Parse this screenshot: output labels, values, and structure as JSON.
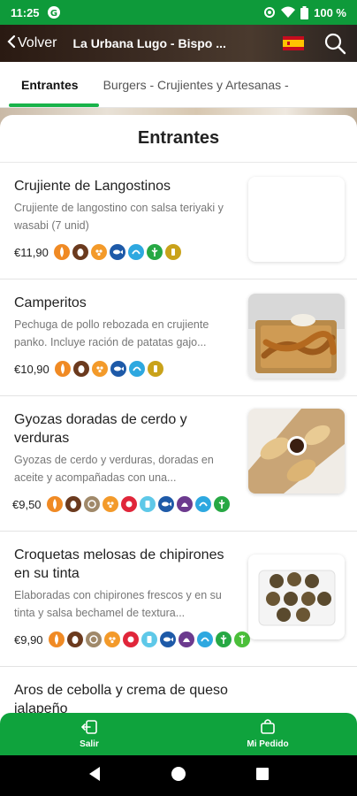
{
  "status_bar": {
    "time": "11:25",
    "battery": "100 %"
  },
  "header": {
    "back_label": "Volver",
    "store_title": "La Urbana Lugo - Bispo ..."
  },
  "tabs": [
    {
      "label": "Entrantes",
      "active": true
    },
    {
      "label": "Burgers - Crujientes y Artesanas -",
      "active": false
    }
  ],
  "section": {
    "title": "Entrantes"
  },
  "items": [
    {
      "name": "Crujiente de Langostinos",
      "description": "Crujiente de langostino con salsa teriyaki y wasabi (7 unid)",
      "price": "€11,90",
      "allergens": [
        "gluten-icon",
        "eggs-icon",
        "sesame-icon",
        "fish-icon",
        "crustacean-icon",
        "celery-icon",
        "mustard-icon"
      ]
    },
    {
      "name": "Camperitos",
      "description": "Pechuga de pollo rebozada en crujiente panko. Incluye ración de patatas gajo...",
      "price": "€10,90",
      "allergens": [
        "gluten-icon",
        "eggs-icon",
        "sesame-icon",
        "fish-icon",
        "crustacean-icon",
        "mustard-icon"
      ]
    },
    {
      "name": "Gyozas doradas de cerdo y verduras",
      "description": "Gyozas de cerdo y verduras, doradas en aceite y acompañadas con una...",
      "price": "€9,50",
      "allergens": [
        "gluten-icon",
        "eggs-icon",
        "nuts-icon",
        "sesame-icon",
        "soy-icon",
        "milk-icon",
        "fish-icon",
        "mollusc-icon",
        "crustacean-icon",
        "celery-icon"
      ]
    },
    {
      "name": "Croquetas melosas de chipirones en su tinta",
      "description": "Elaboradas con chipirones frescos y en su tinta y salsa bechamel de textura...",
      "price": "€9,90",
      "allergens": [
        "gluten-icon",
        "eggs-icon",
        "nuts-icon",
        "sesame-icon",
        "soy-icon",
        "milk-icon",
        "fish-icon",
        "mollusc-icon",
        "crustacean-icon",
        "celery-icon",
        "lupin-icon"
      ]
    },
    {
      "name": "Aros de cebolla y crema de queso jalapeño",
      "description": "",
      "price": "",
      "allergens": []
    }
  ],
  "bottom_bar": {
    "exit_label": "Salir",
    "order_label": "Mi Pedido"
  },
  "colors": {
    "brand_green": "#0fa33d",
    "tab_indicator": "#19b34a"
  }
}
